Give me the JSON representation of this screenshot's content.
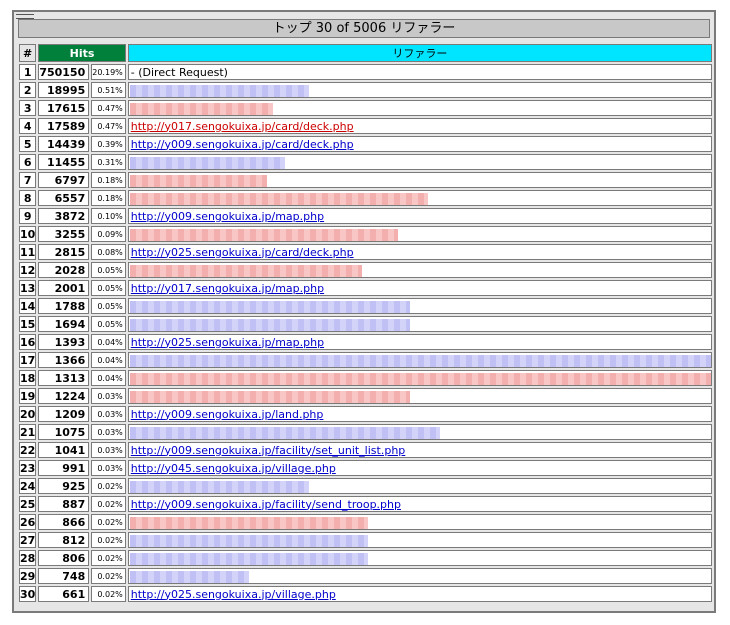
{
  "title": "トップ 30 of 5006 リファラー",
  "headers": {
    "num": "#",
    "hits": "Hits",
    "referrer": "リファラー"
  },
  "colors": {
    "hits_header_bg": "#00803a",
    "referrer_header_bg": "#00e5ff",
    "link": "#0000cc",
    "link_red": "#cc0000"
  },
  "rows": [
    {
      "rank": "1",
      "hits": "750150",
      "pct": "20.19%",
      "ref": "- (Direct Request)",
      "kind": "plain"
    },
    {
      "rank": "2",
      "hits": "18995",
      "pct": "0.51%",
      "ref": "",
      "kind": "blur",
      "blur_color": "blue",
      "blur_len": 0.3
    },
    {
      "rank": "3",
      "hits": "17615",
      "pct": "0.47%",
      "ref": "",
      "kind": "blur",
      "blur_color": "red",
      "blur_len": 0.24
    },
    {
      "rank": "4",
      "hits": "17589",
      "pct": "0.47%",
      "ref": "http://y017.sengokuixa.jp/card/deck.php",
      "kind": "link-red"
    },
    {
      "rank": "5",
      "hits": "14439",
      "pct": "0.39%",
      "ref": "http://y009.sengokuixa.jp/card/deck.php",
      "kind": "link"
    },
    {
      "rank": "6",
      "hits": "11455",
      "pct": "0.31%",
      "ref": "",
      "kind": "blur",
      "blur_color": "blue",
      "blur_len": 0.26
    },
    {
      "rank": "7",
      "hits": "6797",
      "pct": "0.18%",
      "ref": "",
      "kind": "blur",
      "blur_color": "red",
      "blur_len": 0.23
    },
    {
      "rank": "8",
      "hits": "6557",
      "pct": "0.18%",
      "ref": "",
      "kind": "blur",
      "blur_color": "red",
      "blur_len": 0.5
    },
    {
      "rank": "9",
      "hits": "3872",
      "pct": "0.10%",
      "ref": "http://y009.sengokuixa.jp/map.php",
      "kind": "link"
    },
    {
      "rank": "10",
      "hits": "3255",
      "pct": "0.09%",
      "ref": "",
      "kind": "blur",
      "blur_color": "red",
      "blur_len": 0.45
    },
    {
      "rank": "11",
      "hits": "2815",
      "pct": "0.08%",
      "ref": "http://y025.sengokuixa.jp/card/deck.php",
      "kind": "link"
    },
    {
      "rank": "12",
      "hits": "2028",
      "pct": "0.05%",
      "ref": "",
      "kind": "blur",
      "blur_color": "red",
      "blur_len": 0.39
    },
    {
      "rank": "13",
      "hits": "2001",
      "pct": "0.05%",
      "ref": "http://y017.sengokuixa.jp/map.php",
      "kind": "link"
    },
    {
      "rank": "14",
      "hits": "1788",
      "pct": "0.05%",
      "ref": "",
      "kind": "blur",
      "blur_color": "blue",
      "blur_len": 0.47
    },
    {
      "rank": "15",
      "hits": "1694",
      "pct": "0.05%",
      "ref": "",
      "kind": "blur",
      "blur_color": "blue",
      "blur_len": 0.47
    },
    {
      "rank": "16",
      "hits": "1393",
      "pct": "0.04%",
      "ref": "http://y025.sengokuixa.jp/map.php",
      "kind": "link"
    },
    {
      "rank": "17",
      "hits": "1366",
      "pct": "0.04%",
      "ref": "",
      "kind": "blur",
      "blur_color": "blue",
      "blur_len": 0.99
    },
    {
      "rank": "18",
      "hits": "1313",
      "pct": "0.04%",
      "ref": "",
      "kind": "blur",
      "blur_color": "red",
      "blur_len": 0.99
    },
    {
      "rank": "19",
      "hits": "1224",
      "pct": "0.03%",
      "ref": "",
      "kind": "blur",
      "blur_color": "red",
      "blur_len": 0.47
    },
    {
      "rank": "20",
      "hits": "1209",
      "pct": "0.03%",
      "ref": "http://y009.sengokuixa.jp/land.php",
      "kind": "link"
    },
    {
      "rank": "21",
      "hits": "1075",
      "pct": "0.03%",
      "ref": "",
      "kind": "blur",
      "blur_color": "blue",
      "blur_len": 0.52
    },
    {
      "rank": "22",
      "hits": "1041",
      "pct": "0.03%",
      "ref": "http://y009.sengokuixa.jp/facility/set_unit_list.php",
      "kind": "link"
    },
    {
      "rank": "23",
      "hits": "991",
      "pct": "0.03%",
      "ref": "http://y045.sengokuixa.jp/village.php",
      "kind": "link"
    },
    {
      "rank": "24",
      "hits": "925",
      "pct": "0.02%",
      "ref": "",
      "kind": "blur",
      "blur_color": "blue",
      "blur_len": 0.3
    },
    {
      "rank": "25",
      "hits": "887",
      "pct": "0.02%",
      "ref": "http://y009.sengokuixa.jp/facility/send_troop.php",
      "kind": "link"
    },
    {
      "rank": "26",
      "hits": "866",
      "pct": "0.02%",
      "ref": "",
      "kind": "blur",
      "blur_color": "red",
      "blur_len": 0.4
    },
    {
      "rank": "27",
      "hits": "812",
      "pct": "0.02%",
      "ref": "",
      "kind": "blur",
      "blur_color": "blue",
      "blur_len": 0.4
    },
    {
      "rank": "28",
      "hits": "806",
      "pct": "0.02%",
      "ref": "",
      "kind": "blur",
      "blur_color": "blue",
      "blur_len": 0.4
    },
    {
      "rank": "29",
      "hits": "748",
      "pct": "0.02%",
      "ref": "",
      "kind": "blur",
      "blur_color": "blue",
      "blur_len": 0.2
    },
    {
      "rank": "30",
      "hits": "661",
      "pct": "0.02%",
      "ref": "http://y025.sengokuixa.jp/village.php",
      "kind": "link"
    }
  ]
}
